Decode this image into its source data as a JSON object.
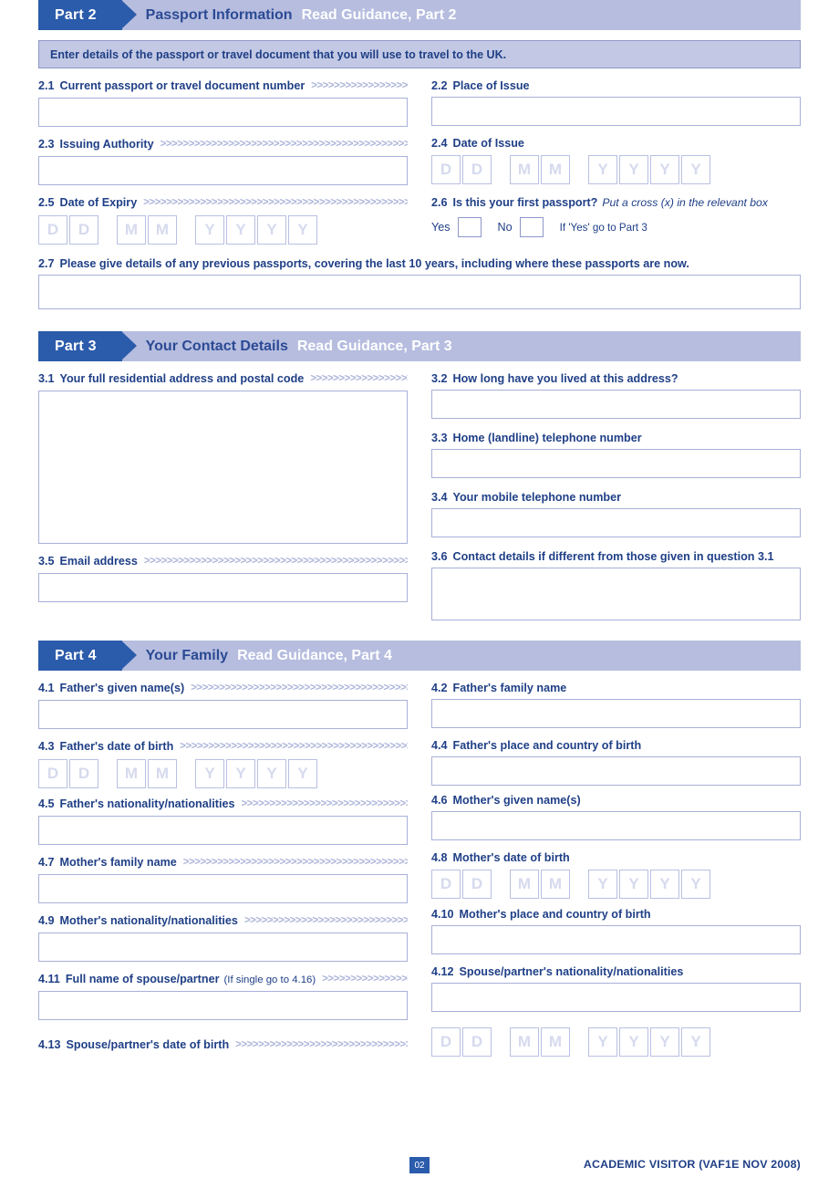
{
  "document": {
    "form_code": "ACADEMIC VISITOR (VAF1E NOV 2008)",
    "page_number": "02",
    "chevrons": ">>>>>>>>>>>>>>>>>>>>>>>>>>>>>>>>>>>>>>>>>>>>>>>>>>>>>>>>>>>>"
  },
  "part2": {
    "tab": "Part 2",
    "title": "Passport Information",
    "guidance": "Read Guidance, Part 2",
    "instruction": "Enter details of the passport or travel document that you will use to travel to the UK.",
    "q21": {
      "num": "2.1",
      "text": "Current passport or travel document number",
      "value": ""
    },
    "q22": {
      "num": "2.2",
      "text": "Place of Issue",
      "value": ""
    },
    "q23": {
      "num": "2.3",
      "text": "Issuing Authority",
      "value": ""
    },
    "q24": {
      "num": "2.4",
      "text": "Date of Issue"
    },
    "q25": {
      "num": "2.5",
      "text": "Date of Expiry"
    },
    "q26": {
      "num": "2.6",
      "text": "Is this your first passport?",
      "note": "Put a cross (x) in the relevant box",
      "yes_label": "Yes",
      "no_label": "No",
      "hint": "If 'Yes' go to Part 3"
    },
    "q27": {
      "num": "2.7",
      "text": "Please give details of any previous passports, covering the last 10 years, including where these passports are now.",
      "value": ""
    }
  },
  "part3": {
    "tab": "Part 3",
    "title": "Your Contact Details",
    "guidance": "Read Guidance, Part 3",
    "q31": {
      "num": "3.1",
      "text": "Your full residential address and postal code",
      "value": ""
    },
    "q32": {
      "num": "3.2",
      "text": "How long have you lived at this address?",
      "value": ""
    },
    "q33": {
      "num": "3.3",
      "text": "Home (landline) telephone number",
      "value": ""
    },
    "q34": {
      "num": "3.4",
      "text": "Your mobile telephone number",
      "value": ""
    },
    "q35": {
      "num": "3.5",
      "text": "Email address",
      "value": ""
    },
    "q36": {
      "num": "3.6",
      "text": "Contact details if different from those given in question 3.1",
      "value": ""
    }
  },
  "part4": {
    "tab": "Part 4",
    "title": "Your Family",
    "guidance": "Read Guidance, Part 4",
    "q41": {
      "num": "4.1",
      "text": "Father's given name(s)",
      "value": ""
    },
    "q42": {
      "num": "4.2",
      "text": "Father's family name",
      "value": ""
    },
    "q43": {
      "num": "4.3",
      "text": "Father's date of birth"
    },
    "q44": {
      "num": "4.4",
      "text": "Father's place and country of birth",
      "value": ""
    },
    "q45": {
      "num": "4.5",
      "text": "Father's nationality/nationalities",
      "value": ""
    },
    "q46": {
      "num": "4.6",
      "text": "Mother's given name(s)",
      "value": ""
    },
    "q47": {
      "num": "4.7",
      "text": "Mother's family name",
      "value": ""
    },
    "q48": {
      "num": "4.8",
      "text": "Mother's date of birth"
    },
    "q49": {
      "num": "4.9",
      "text": "Mother's nationality/nationalities",
      "value": ""
    },
    "q410": {
      "num": "4.10",
      "text": "Mother's place and country of birth",
      "value": ""
    },
    "q411": {
      "num": "4.11",
      "text": "Full name of spouse/partner",
      "note": "(If single go to 4.16)",
      "value": ""
    },
    "q412": {
      "num": "4.12",
      "text": "Spouse/partner's nationality/nationalities",
      "value": ""
    },
    "q413": {
      "num": "4.13",
      "text": "Spouse/partner's date of birth"
    }
  },
  "date_placeholders": {
    "d": "D",
    "m": "M",
    "y": "Y"
  },
  "colors": {
    "brand_blue": "#2b5bab",
    "text_blue": "#1f3f86",
    "band_lavender": "#b6bddf",
    "instruction_bg": "#c3c9e4",
    "field_border": "#a8b0d8",
    "chevron": "#aeb6da"
  }
}
